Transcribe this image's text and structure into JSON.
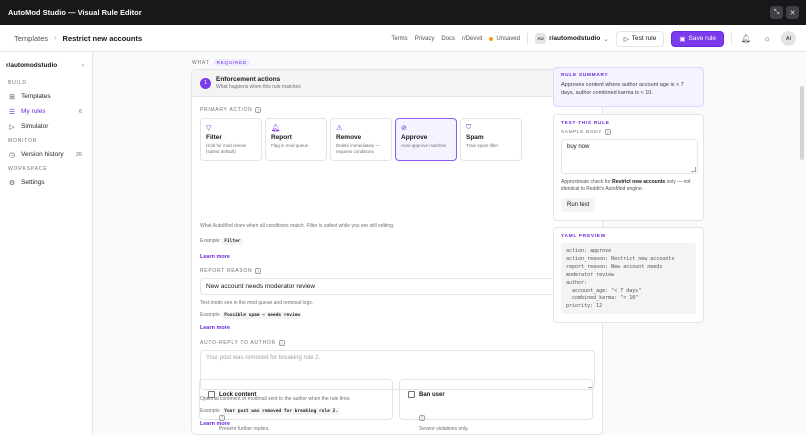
{
  "window": {
    "title": "AutoMod Studio — Visual Rule Editor"
  },
  "header": {
    "breadcrumb_parent": "Templates",
    "breadcrumb_sep": "›",
    "breadcrumb_current": "Restrict new accounts",
    "links": [
      "Terms",
      "Privacy",
      "Docs",
      "r/Devvit"
    ],
    "unsaved": "Unsaved",
    "workspace_badge": "AU",
    "workspace": "r/automodstudio",
    "test_rule": "Test rule",
    "save_rule": "Save rule",
    "avatar": "AI"
  },
  "sidebar": {
    "workspace": "r/automodstudio",
    "sections": [
      {
        "title": "BUILD",
        "items": [
          {
            "label": "Templates",
            "icon": "grid-icon"
          },
          {
            "label": "My rules",
            "icon": "list-icon",
            "count": "6",
            "active": true
          },
          {
            "label": "Simulator",
            "icon": "play-icon"
          }
        ]
      },
      {
        "title": "MONITOR",
        "items": [
          {
            "label": "Version history",
            "icon": "clock-icon",
            "count": "26"
          }
        ]
      },
      {
        "title": "WORKSPACE",
        "items": [
          {
            "label": "Settings",
            "icon": "gear-icon"
          }
        ]
      }
    ]
  },
  "editor": {
    "section_label": "WHAT",
    "required": "REQUIRED",
    "step_number": "1",
    "title": "Enforcement actions",
    "subtitle": "What happens when this rule matches",
    "primary_action_label": "PRIMARY ACTION",
    "help_glyph": "?",
    "actions": [
      {
        "name": "Filter",
        "desc": "Hold for mod review (safest default)"
      },
      {
        "name": "Report",
        "desc": "Flag in mod queue"
      },
      {
        "name": "Remove",
        "desc": "Delete immediately — requires conditions"
      },
      {
        "name": "Approve",
        "desc": "Auto-approve matches",
        "selected": true
      },
      {
        "name": "Spam",
        "desc": "Train spam filter"
      }
    ],
    "action_help": "What AutoMod does when all conditions match. Filter is safest while you are still editing.",
    "example_prefix": "Example:",
    "action_example": "Filter",
    "learn_more": "Learn more",
    "report_reason_label": "REPORT REASON",
    "report_reason_value": "New account needs moderator review",
    "report_help": "Text mods see in the mod queue and removal logs.",
    "report_example": "Possible spam — needs review",
    "auto_reply_label": "AUTO-REPLY TO AUTHOR",
    "auto_reply_placeholder": "Your post was removed for breaking rule 2.",
    "auto_reply_help": "Optional comment or modmail sent to the author when the rule fires.",
    "auto_reply_example": "Your post was removed for breaking rule 2.",
    "lock_title": "Lock content",
    "lock_desc": "Prevent further replies.",
    "ban_title": "Ban user",
    "ban_desc": "Severe violations only."
  },
  "summary": {
    "title": "RULE SUMMARY",
    "text": "Approves content where author account age is < 7 days, author combined karma is < 10."
  },
  "test": {
    "title": "TEST THIS RULE",
    "sample_label": "SAMPLE BODY",
    "sample_value": "buy now",
    "approx_prefix": "Approximate check for ",
    "approx_bold": "Restrict new accounts",
    "approx_suffix": " only — not identical to Reddit's AutoMod engine.",
    "run": "Run test"
  },
  "yaml": {
    "title": "YAML PREVIEW",
    "lines": [
      "action: approve",
      "action_reason: Restrict new accounts",
      "report_reason: New account needs",
      "moderator review",
      "author:",
      "  account_age: \"< 7 days\"",
      "  combined_karma: \"< 10\"",
      "priority: 12"
    ]
  },
  "colors": {
    "accent": "#7c3aed",
    "titlebar": "#18181b",
    "unsaved_dot": "#f59e0b"
  }
}
